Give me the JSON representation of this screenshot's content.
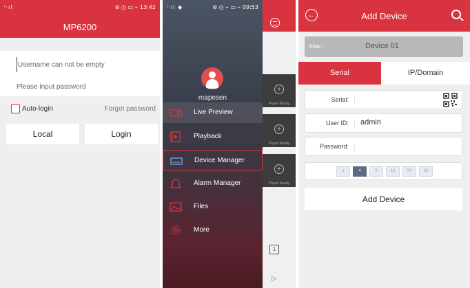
{
  "panel1": {
    "status": {
      "signal": "ⁱ‧ıl",
      "right": "⊛ ◷ ▭ ⌁ 13:42"
    },
    "app_title": "MP6200",
    "username_placeholder": "Username can not be empty",
    "password_placeholder": "Please input password",
    "auto_login_label": "Auto-login",
    "forgot_password_label": "Forgot password",
    "local_button": "Local",
    "login_button": "Login",
    "accent_color": "#d9333f"
  },
  "panel2": {
    "status": {
      "signal": "ⁱ‧ıl ◆",
      "right": "⊛ ◷ ⌁ ▭ ⌁ 09:53"
    },
    "username": "mapesen",
    "menu": [
      {
        "label": "Live Preview",
        "icon": "camera-icon"
      },
      {
        "label": "Playback",
        "icon": "film-icon"
      },
      {
        "label": "Device Manager",
        "icon": "dvr-icon"
      },
      {
        "label": "Alarm Manager",
        "icon": "bell-icon"
      },
      {
        "label": "Files",
        "icon": "image-icon"
      },
      {
        "label": "More",
        "icon": "gear-icon"
      }
    ],
    "selected_item": "Device Manager",
    "player_ready": "Player Ready",
    "layout_button": "1"
  },
  "panel3": {
    "title": "Add Device",
    "alias_label": "Alias :",
    "alias_value": "Device 01",
    "tab_serial": "Serial",
    "tab_ip": "IP/Domain",
    "serial_label": "Serial:",
    "serial_value": "",
    "user_label": "User ID:",
    "user_value": "admin",
    "password_label": "Password:",
    "password_value": "",
    "channels": [
      "1",
      "4",
      "8",
      "16",
      "24",
      "32"
    ],
    "selected_channel": "4",
    "add_button": "Add Device"
  }
}
